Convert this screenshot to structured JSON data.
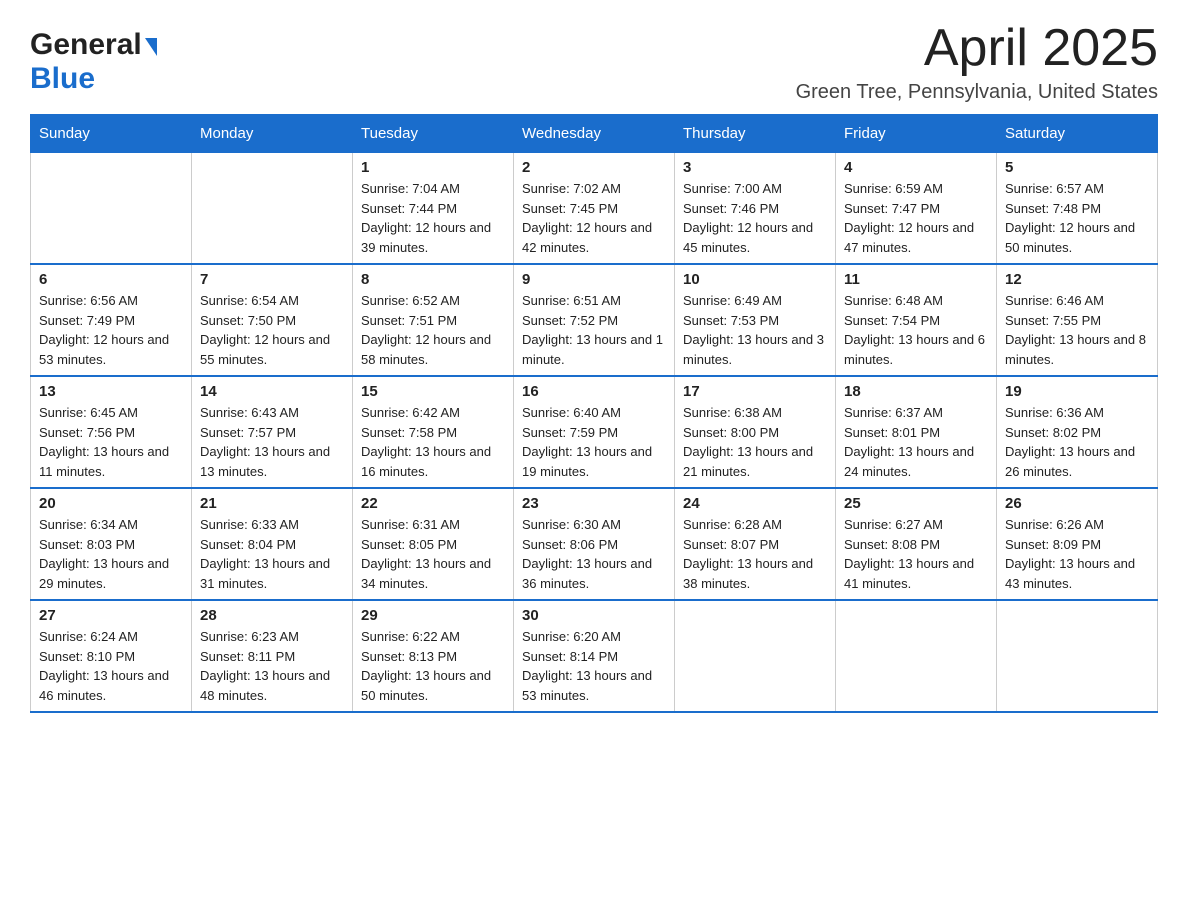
{
  "logo": {
    "general": "General",
    "blue": "Blue"
  },
  "title": "April 2025",
  "location": "Green Tree, Pennsylvania, United States",
  "weekdays": [
    "Sunday",
    "Monday",
    "Tuesday",
    "Wednesday",
    "Thursday",
    "Friday",
    "Saturday"
  ],
  "weeks": [
    [
      {
        "day": "",
        "sunrise": "",
        "sunset": "",
        "daylight": ""
      },
      {
        "day": "",
        "sunrise": "",
        "sunset": "",
        "daylight": ""
      },
      {
        "day": "1",
        "sunrise": "Sunrise: 7:04 AM",
        "sunset": "Sunset: 7:44 PM",
        "daylight": "Daylight: 12 hours and 39 minutes."
      },
      {
        "day": "2",
        "sunrise": "Sunrise: 7:02 AM",
        "sunset": "Sunset: 7:45 PM",
        "daylight": "Daylight: 12 hours and 42 minutes."
      },
      {
        "day": "3",
        "sunrise": "Sunrise: 7:00 AM",
        "sunset": "Sunset: 7:46 PM",
        "daylight": "Daylight: 12 hours and 45 minutes."
      },
      {
        "day": "4",
        "sunrise": "Sunrise: 6:59 AM",
        "sunset": "Sunset: 7:47 PM",
        "daylight": "Daylight: 12 hours and 47 minutes."
      },
      {
        "day": "5",
        "sunrise": "Sunrise: 6:57 AM",
        "sunset": "Sunset: 7:48 PM",
        "daylight": "Daylight: 12 hours and 50 minutes."
      }
    ],
    [
      {
        "day": "6",
        "sunrise": "Sunrise: 6:56 AM",
        "sunset": "Sunset: 7:49 PM",
        "daylight": "Daylight: 12 hours and 53 minutes."
      },
      {
        "day": "7",
        "sunrise": "Sunrise: 6:54 AM",
        "sunset": "Sunset: 7:50 PM",
        "daylight": "Daylight: 12 hours and 55 minutes."
      },
      {
        "day": "8",
        "sunrise": "Sunrise: 6:52 AM",
        "sunset": "Sunset: 7:51 PM",
        "daylight": "Daylight: 12 hours and 58 minutes."
      },
      {
        "day": "9",
        "sunrise": "Sunrise: 6:51 AM",
        "sunset": "Sunset: 7:52 PM",
        "daylight": "Daylight: 13 hours and 1 minute."
      },
      {
        "day": "10",
        "sunrise": "Sunrise: 6:49 AM",
        "sunset": "Sunset: 7:53 PM",
        "daylight": "Daylight: 13 hours and 3 minutes."
      },
      {
        "day": "11",
        "sunrise": "Sunrise: 6:48 AM",
        "sunset": "Sunset: 7:54 PM",
        "daylight": "Daylight: 13 hours and 6 minutes."
      },
      {
        "day": "12",
        "sunrise": "Sunrise: 6:46 AM",
        "sunset": "Sunset: 7:55 PM",
        "daylight": "Daylight: 13 hours and 8 minutes."
      }
    ],
    [
      {
        "day": "13",
        "sunrise": "Sunrise: 6:45 AM",
        "sunset": "Sunset: 7:56 PM",
        "daylight": "Daylight: 13 hours and 11 minutes."
      },
      {
        "day": "14",
        "sunrise": "Sunrise: 6:43 AM",
        "sunset": "Sunset: 7:57 PM",
        "daylight": "Daylight: 13 hours and 13 minutes."
      },
      {
        "day": "15",
        "sunrise": "Sunrise: 6:42 AM",
        "sunset": "Sunset: 7:58 PM",
        "daylight": "Daylight: 13 hours and 16 minutes."
      },
      {
        "day": "16",
        "sunrise": "Sunrise: 6:40 AM",
        "sunset": "Sunset: 7:59 PM",
        "daylight": "Daylight: 13 hours and 19 minutes."
      },
      {
        "day": "17",
        "sunrise": "Sunrise: 6:38 AM",
        "sunset": "Sunset: 8:00 PM",
        "daylight": "Daylight: 13 hours and 21 minutes."
      },
      {
        "day": "18",
        "sunrise": "Sunrise: 6:37 AM",
        "sunset": "Sunset: 8:01 PM",
        "daylight": "Daylight: 13 hours and 24 minutes."
      },
      {
        "day": "19",
        "sunrise": "Sunrise: 6:36 AM",
        "sunset": "Sunset: 8:02 PM",
        "daylight": "Daylight: 13 hours and 26 minutes."
      }
    ],
    [
      {
        "day": "20",
        "sunrise": "Sunrise: 6:34 AM",
        "sunset": "Sunset: 8:03 PM",
        "daylight": "Daylight: 13 hours and 29 minutes."
      },
      {
        "day": "21",
        "sunrise": "Sunrise: 6:33 AM",
        "sunset": "Sunset: 8:04 PM",
        "daylight": "Daylight: 13 hours and 31 minutes."
      },
      {
        "day": "22",
        "sunrise": "Sunrise: 6:31 AM",
        "sunset": "Sunset: 8:05 PM",
        "daylight": "Daylight: 13 hours and 34 minutes."
      },
      {
        "day": "23",
        "sunrise": "Sunrise: 6:30 AM",
        "sunset": "Sunset: 8:06 PM",
        "daylight": "Daylight: 13 hours and 36 minutes."
      },
      {
        "day": "24",
        "sunrise": "Sunrise: 6:28 AM",
        "sunset": "Sunset: 8:07 PM",
        "daylight": "Daylight: 13 hours and 38 minutes."
      },
      {
        "day": "25",
        "sunrise": "Sunrise: 6:27 AM",
        "sunset": "Sunset: 8:08 PM",
        "daylight": "Daylight: 13 hours and 41 minutes."
      },
      {
        "day": "26",
        "sunrise": "Sunrise: 6:26 AM",
        "sunset": "Sunset: 8:09 PM",
        "daylight": "Daylight: 13 hours and 43 minutes."
      }
    ],
    [
      {
        "day": "27",
        "sunrise": "Sunrise: 6:24 AM",
        "sunset": "Sunset: 8:10 PM",
        "daylight": "Daylight: 13 hours and 46 minutes."
      },
      {
        "day": "28",
        "sunrise": "Sunrise: 6:23 AM",
        "sunset": "Sunset: 8:11 PM",
        "daylight": "Daylight: 13 hours and 48 minutes."
      },
      {
        "day": "29",
        "sunrise": "Sunrise: 6:22 AM",
        "sunset": "Sunset: 8:13 PM",
        "daylight": "Daylight: 13 hours and 50 minutes."
      },
      {
        "day": "30",
        "sunrise": "Sunrise: 6:20 AM",
        "sunset": "Sunset: 8:14 PM",
        "daylight": "Daylight: 13 hours and 53 minutes."
      },
      {
        "day": "",
        "sunrise": "",
        "sunset": "",
        "daylight": ""
      },
      {
        "day": "",
        "sunrise": "",
        "sunset": "",
        "daylight": ""
      },
      {
        "day": "",
        "sunrise": "",
        "sunset": "",
        "daylight": ""
      }
    ]
  ]
}
